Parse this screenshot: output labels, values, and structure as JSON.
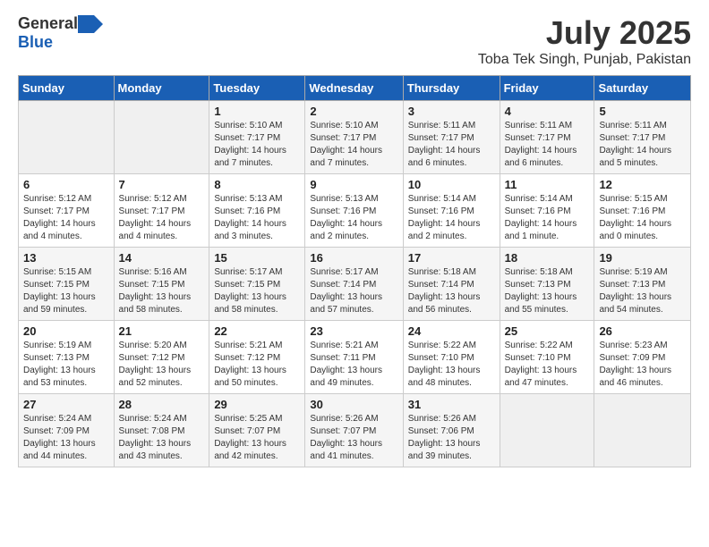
{
  "logo": {
    "general": "General",
    "blue": "Blue"
  },
  "title": {
    "month": "July 2025",
    "location": "Toba Tek Singh, Punjab, Pakistan"
  },
  "headers": [
    "Sunday",
    "Monday",
    "Tuesday",
    "Wednesday",
    "Thursday",
    "Friday",
    "Saturday"
  ],
  "weeks": [
    [
      {
        "day": "",
        "detail": ""
      },
      {
        "day": "",
        "detail": ""
      },
      {
        "day": "1",
        "detail": "Sunrise: 5:10 AM\nSunset: 7:17 PM\nDaylight: 14 hours\nand 7 minutes."
      },
      {
        "day": "2",
        "detail": "Sunrise: 5:10 AM\nSunset: 7:17 PM\nDaylight: 14 hours\nand 7 minutes."
      },
      {
        "day": "3",
        "detail": "Sunrise: 5:11 AM\nSunset: 7:17 PM\nDaylight: 14 hours\nand 6 minutes."
      },
      {
        "day": "4",
        "detail": "Sunrise: 5:11 AM\nSunset: 7:17 PM\nDaylight: 14 hours\nand 6 minutes."
      },
      {
        "day": "5",
        "detail": "Sunrise: 5:11 AM\nSunset: 7:17 PM\nDaylight: 14 hours\nand 5 minutes."
      }
    ],
    [
      {
        "day": "6",
        "detail": "Sunrise: 5:12 AM\nSunset: 7:17 PM\nDaylight: 14 hours\nand 4 minutes."
      },
      {
        "day": "7",
        "detail": "Sunrise: 5:12 AM\nSunset: 7:17 PM\nDaylight: 14 hours\nand 4 minutes."
      },
      {
        "day": "8",
        "detail": "Sunrise: 5:13 AM\nSunset: 7:16 PM\nDaylight: 14 hours\nand 3 minutes."
      },
      {
        "day": "9",
        "detail": "Sunrise: 5:13 AM\nSunset: 7:16 PM\nDaylight: 14 hours\nand 2 minutes."
      },
      {
        "day": "10",
        "detail": "Sunrise: 5:14 AM\nSunset: 7:16 PM\nDaylight: 14 hours\nand 2 minutes."
      },
      {
        "day": "11",
        "detail": "Sunrise: 5:14 AM\nSunset: 7:16 PM\nDaylight: 14 hours\nand 1 minute."
      },
      {
        "day": "12",
        "detail": "Sunrise: 5:15 AM\nSunset: 7:16 PM\nDaylight: 14 hours\nand 0 minutes."
      }
    ],
    [
      {
        "day": "13",
        "detail": "Sunrise: 5:15 AM\nSunset: 7:15 PM\nDaylight: 13 hours\nand 59 minutes."
      },
      {
        "day": "14",
        "detail": "Sunrise: 5:16 AM\nSunset: 7:15 PM\nDaylight: 13 hours\nand 58 minutes."
      },
      {
        "day": "15",
        "detail": "Sunrise: 5:17 AM\nSunset: 7:15 PM\nDaylight: 13 hours\nand 58 minutes."
      },
      {
        "day": "16",
        "detail": "Sunrise: 5:17 AM\nSunset: 7:14 PM\nDaylight: 13 hours\nand 57 minutes."
      },
      {
        "day": "17",
        "detail": "Sunrise: 5:18 AM\nSunset: 7:14 PM\nDaylight: 13 hours\nand 56 minutes."
      },
      {
        "day": "18",
        "detail": "Sunrise: 5:18 AM\nSunset: 7:13 PM\nDaylight: 13 hours\nand 55 minutes."
      },
      {
        "day": "19",
        "detail": "Sunrise: 5:19 AM\nSunset: 7:13 PM\nDaylight: 13 hours\nand 54 minutes."
      }
    ],
    [
      {
        "day": "20",
        "detail": "Sunrise: 5:19 AM\nSunset: 7:13 PM\nDaylight: 13 hours\nand 53 minutes."
      },
      {
        "day": "21",
        "detail": "Sunrise: 5:20 AM\nSunset: 7:12 PM\nDaylight: 13 hours\nand 52 minutes."
      },
      {
        "day": "22",
        "detail": "Sunrise: 5:21 AM\nSunset: 7:12 PM\nDaylight: 13 hours\nand 50 minutes."
      },
      {
        "day": "23",
        "detail": "Sunrise: 5:21 AM\nSunset: 7:11 PM\nDaylight: 13 hours\nand 49 minutes."
      },
      {
        "day": "24",
        "detail": "Sunrise: 5:22 AM\nSunset: 7:10 PM\nDaylight: 13 hours\nand 48 minutes."
      },
      {
        "day": "25",
        "detail": "Sunrise: 5:22 AM\nSunset: 7:10 PM\nDaylight: 13 hours\nand 47 minutes."
      },
      {
        "day": "26",
        "detail": "Sunrise: 5:23 AM\nSunset: 7:09 PM\nDaylight: 13 hours\nand 46 minutes."
      }
    ],
    [
      {
        "day": "27",
        "detail": "Sunrise: 5:24 AM\nSunset: 7:09 PM\nDaylight: 13 hours\nand 44 minutes."
      },
      {
        "day": "28",
        "detail": "Sunrise: 5:24 AM\nSunset: 7:08 PM\nDaylight: 13 hours\nand 43 minutes."
      },
      {
        "day": "29",
        "detail": "Sunrise: 5:25 AM\nSunset: 7:07 PM\nDaylight: 13 hours\nand 42 minutes."
      },
      {
        "day": "30",
        "detail": "Sunrise: 5:26 AM\nSunset: 7:07 PM\nDaylight: 13 hours\nand 41 minutes."
      },
      {
        "day": "31",
        "detail": "Sunrise: 5:26 AM\nSunset: 7:06 PM\nDaylight: 13 hours\nand 39 minutes."
      },
      {
        "day": "",
        "detail": ""
      },
      {
        "day": "",
        "detail": ""
      }
    ]
  ]
}
